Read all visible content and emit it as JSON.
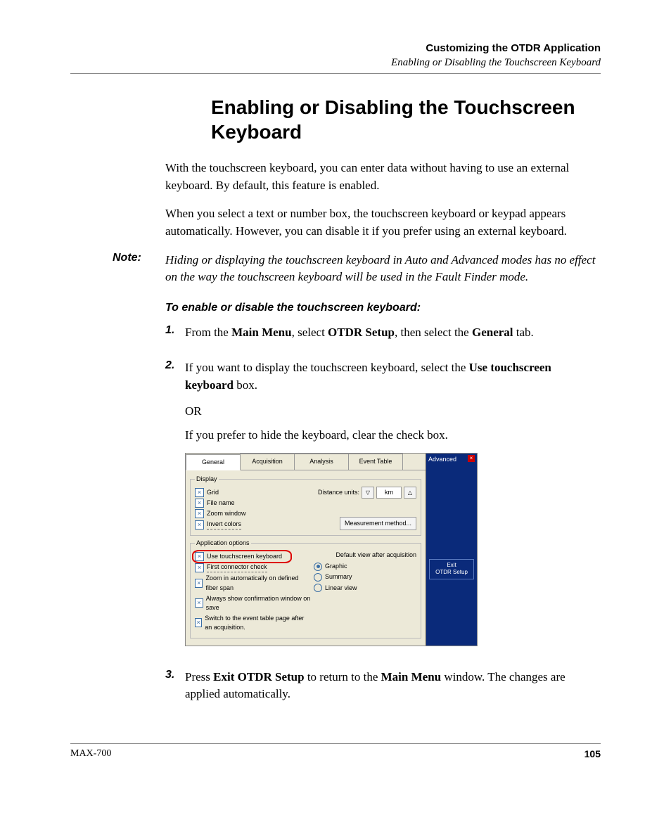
{
  "header": {
    "chapter": "Customizing the OTDR Application",
    "section": "Enabling or Disabling the Touchscreen Keyboard"
  },
  "title": "Enabling or Disabling the Touchscreen Keyboard",
  "paragraphs": {
    "p1": "With the touchscreen keyboard, you can enter data without having to use an external keyboard. By default, this feature is enabled.",
    "p2": "When you select a text or number box, the touchscreen keyboard or keypad appears automatically. However, you can disable it if you prefer using an external keyboard."
  },
  "note": {
    "label": "Note:",
    "text": "Hiding or displaying the touchscreen keyboard in Auto and Advanced modes has no effect on the way the touchscreen keyboard will be used in the Fault Finder mode."
  },
  "task_title": "To enable or disable the touchscreen keyboard:",
  "steps": {
    "s1": {
      "pre": "From the ",
      "b1": "Main Menu",
      "mid1": ", select ",
      "b2": "OTDR Setup",
      "mid2": ", then select the ",
      "b3": "General",
      "post": " tab."
    },
    "s2": {
      "line1_pre": "If you want to display the touchscreen keyboard, select the ",
      "line1_b": "Use touchscreen keyboard",
      "line1_post": " box.",
      "or": "OR",
      "line2": "If you prefer to hide the keyboard, clear the check box."
    },
    "s3": {
      "pre": "Press ",
      "b1": "Exit OTDR Setup",
      "mid": " to return to the ",
      "b2": "Main Menu",
      "post": " window. The changes are applied automatically."
    }
  },
  "screenshot": {
    "tabs": [
      "General",
      "Acquisition",
      "Analysis",
      "Event Table"
    ],
    "active_tab": "General",
    "group_display": "Display",
    "group_app": "Application options",
    "chk_grid": "Grid",
    "chk_filename": "File name",
    "chk_zoom": "Zoom window",
    "chk_invert": "Invert colors",
    "distance_label": "Distance units:",
    "distance_value": "km",
    "mm_button": "Measurement method...",
    "chk_use_kbd": "Use touchscreen keyboard",
    "chk_first_conn": "First connector check",
    "chk_zoom_auto": "Zoom in automatically on defined fiber span",
    "chk_always_confirm": "Always show confirmation window on save",
    "chk_switch_event": "Switch to the event table page after an acquisition.",
    "default_view_label": "Default view after acquisition",
    "radio_graphic": "Graphic",
    "radio_summary": "Summary",
    "radio_linear": "Linear view",
    "side_mode": "Advanced",
    "side_exit_l1": "Exit",
    "side_exit_l2": "OTDR Setup"
  },
  "footer": {
    "model": "MAX-700",
    "page": "105"
  }
}
